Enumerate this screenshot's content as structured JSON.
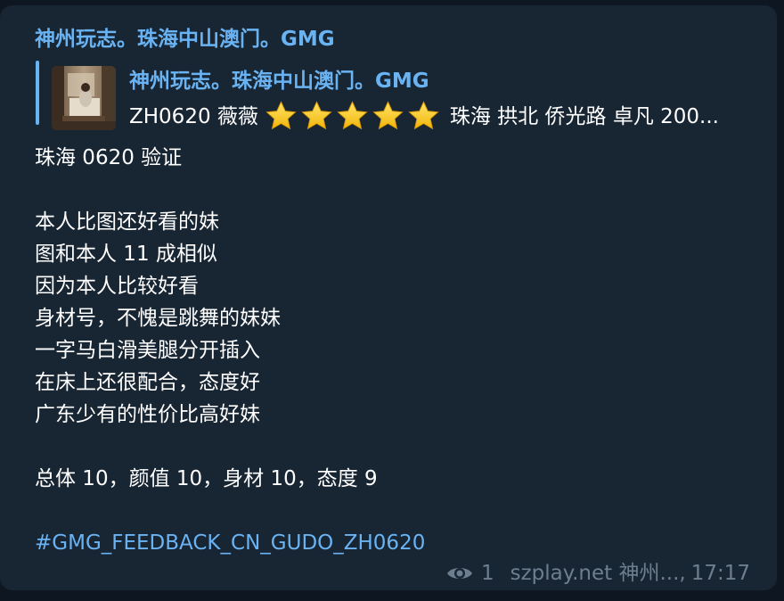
{
  "message": {
    "sender": "神州玩志。珠海中山澳门。GMG",
    "reply": {
      "title": "神州玩志。珠海中山澳门。GMG",
      "text_before": "ZH0620 薇薇",
      "star_count": 5,
      "text_after": "珠海 拱北 侨光路 卓凡 200..."
    },
    "body_lines": [
      "珠海 0620 验证",
      "",
      "本人比图还好看的妹",
      "图和本人 11 成相似",
      "因为本人比较好看",
      "身材号，不愧是跳舞的妹妹",
      "一字马白滑美腿分开插入",
      "在床上还很配合，态度好",
      "广东少有的性价比高好妹",
      "",
      "总体 10，颜值 10，身材 10，态度 9",
      ""
    ],
    "hashtag": "#GMG_FEEDBACK_CN_GUDO_ZH0620",
    "footer": {
      "views": "1",
      "signature": "szplay.net 神州...,",
      "time": "17:17"
    }
  },
  "colors": {
    "background": "#0e1621",
    "bubble": "#182533",
    "accent": "#6ab3f3",
    "meta": "#6d7f8f"
  },
  "icons": {
    "star": "star-icon",
    "views": "eye-icon"
  }
}
